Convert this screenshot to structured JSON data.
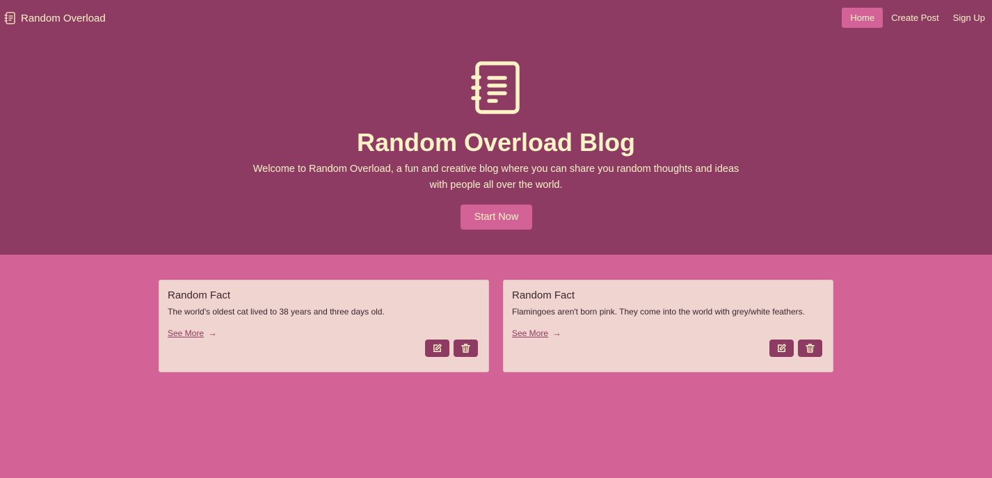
{
  "nav": {
    "brand": "Random Overload",
    "brand_icon": "notebook-icon",
    "links": [
      {
        "label": "Home",
        "active": true
      },
      {
        "label": "Create Post",
        "active": false
      },
      {
        "label": "Sign Up",
        "active": false
      }
    ]
  },
  "hero": {
    "icon": "notebook-icon",
    "title": "Random Overload Blog",
    "subtitle": "Welcome to Random Overload, a fun and creative blog where you can share you random thoughts and ideas with people all over the world.",
    "cta": "Start Now"
  },
  "posts": [
    {
      "title": "Random Fact",
      "text": "The world's oldest cat lived to 38 years and three days old.",
      "link": "See More",
      "arrow": "→",
      "edit_icon": "edit-icon",
      "delete_icon": "trash-icon"
    },
    {
      "title": "Random Fact",
      "text": "Flamingoes aren't born pink. They come into the world with grey/white feathers.",
      "link": "See More",
      "arrow": "→",
      "edit_icon": "edit-icon",
      "delete_icon": "trash-icon"
    }
  ],
  "colors": {
    "header_bg": "#8e3b63",
    "accent": "#d36397",
    "text_cream": "#fdf3c6",
    "card_bg": "#efd4cf"
  }
}
